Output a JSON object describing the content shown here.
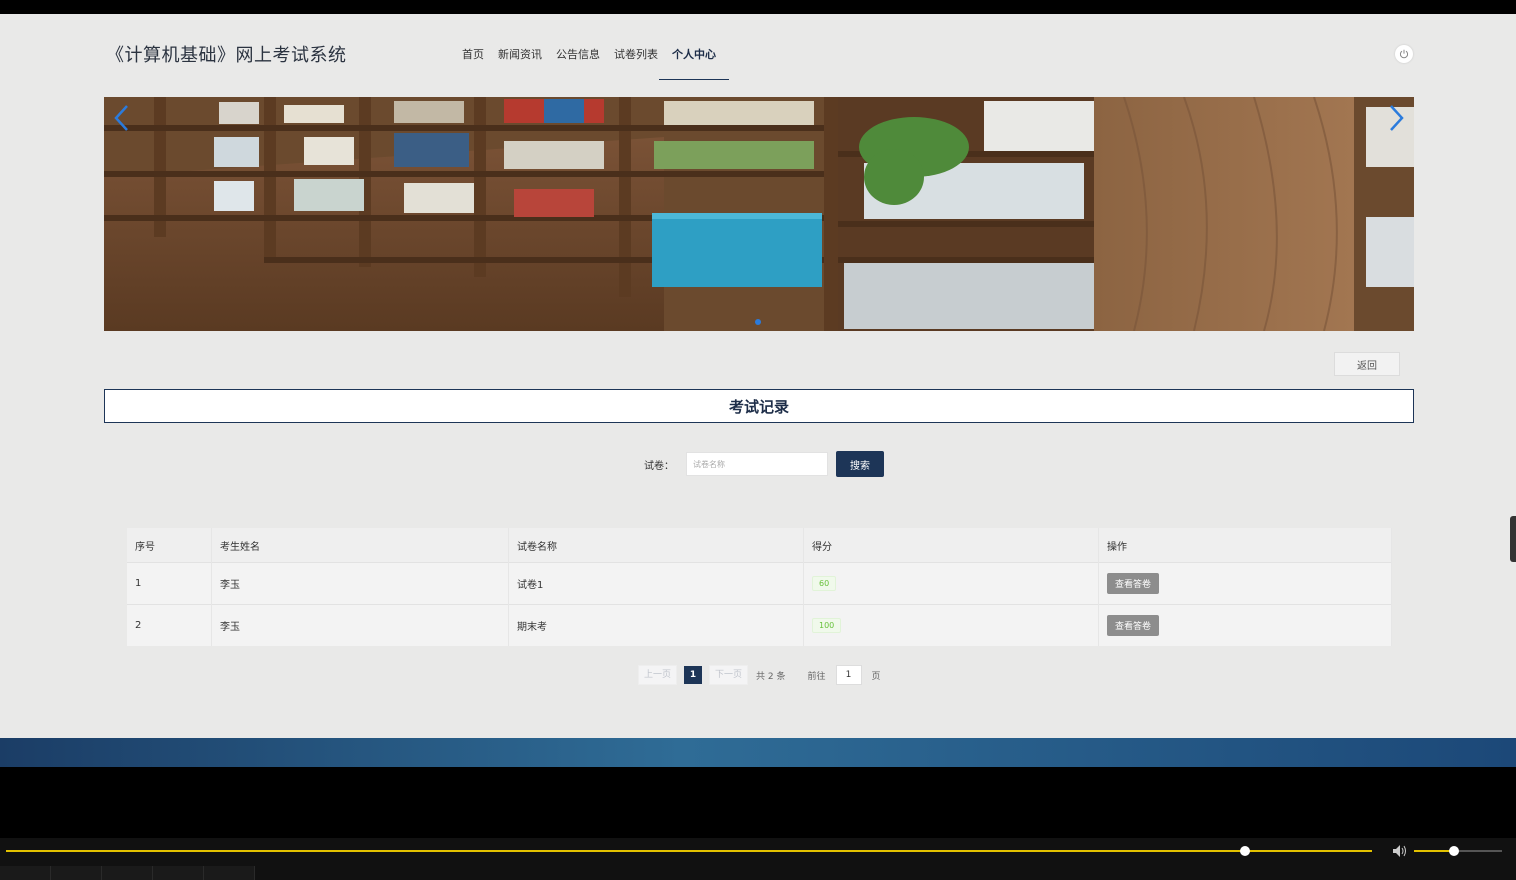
{
  "header": {
    "site_title": "《计算机基础》网上考试系统",
    "nav": [
      {
        "label": "首页"
      },
      {
        "label": "新闻资讯"
      },
      {
        "label": "公告信息"
      },
      {
        "label": "试卷列表"
      },
      {
        "label": "个人中心"
      }
    ],
    "active_nav": "个人中心",
    "power_icon": "power-icon"
  },
  "banner": {
    "slide_index": 1,
    "slide_count": 1
  },
  "actions": {
    "back_label": "返回"
  },
  "section": {
    "title": "考试记录"
  },
  "search": {
    "label": "试卷：",
    "placeholder": "试卷名称",
    "button_label": "搜索"
  },
  "table": {
    "columns": [
      "序号",
      "考生姓名",
      "试卷名称",
      "得分",
      "操作"
    ],
    "rows": [
      {
        "index": "1",
        "name": "李玉",
        "paper": "试卷1",
        "score": "60",
        "action": "查看答卷"
      },
      {
        "index": "2",
        "name": "李玉",
        "paper": "期末考",
        "score": "100",
        "action": "查看答卷"
      }
    ]
  },
  "pagination": {
    "prev": "上一页",
    "current": "1",
    "next": "下一页",
    "total": "共 2 条",
    "goto": "前往",
    "goto_value": "1",
    "page_unit": "页"
  },
  "colors": {
    "primary": "#1d3557",
    "score_green": "#67c23a",
    "footer_start": "#1b3d66",
    "footer_mid": "#2f6c96",
    "progress": "#e2c100"
  },
  "player": {
    "progress_fraction": 0.9,
    "volume_fraction": 0.45
  }
}
